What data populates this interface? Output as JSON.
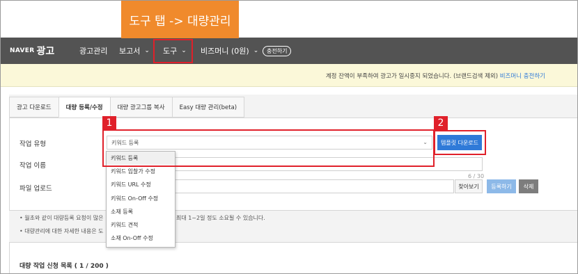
{
  "caption": "도구 탭 -> 대량관리",
  "nav": {
    "logo_naver": "NAVER",
    "logo_ad": "광고",
    "items": [
      {
        "label": "광고관리",
        "chevron": false
      },
      {
        "label": "보고서",
        "chevron": true
      },
      {
        "label": "도구",
        "chevron": true
      },
      {
        "label": "비즈머니 (0원)",
        "chevron": true
      }
    ],
    "charge_button": "충전하기",
    "chevron_icon": "chevron-down-icon"
  },
  "notice": {
    "text": "계정 잔액이 부족하여 광고가 일시중지 되었습니다. (브랜드검색 제외)",
    "link": "비즈머니 충전하기"
  },
  "tabs": [
    {
      "label": "광고 다운로드",
      "active": false
    },
    {
      "label": "대량 등록/수정",
      "active": true
    },
    {
      "label": "대량 광고그룹 복사",
      "active": false
    },
    {
      "label": "Easy 대량 관리(beta)",
      "active": false
    }
  ],
  "form": {
    "job_type_label": "작업 유형",
    "job_name_label": "작업 이름",
    "file_upload_label": "파일 업로드",
    "job_type_value": "키워드 등록",
    "counter": "6 / 30",
    "find_button": "찾아보기",
    "register_button": "등록하기",
    "delete_button": "삭제",
    "template_button": "템플릿 다운로드"
  },
  "dropdown": {
    "options": [
      "키워드 등록",
      "키워드 입찰가 수정",
      "키워드 URL 수정",
      "키워드 On-Off 수정",
      "소재 등록",
      "키워드 견적",
      "소재 On-Off 수정"
    ],
    "selected_index": 0
  },
  "notes": {
    "note1_head": "• 월초와 같이 대량등록 요청이 많은",
    "note1_tail": "최대 1~2일 정도 소요될 수 있습니다.",
    "note2": "• 대량관리에 대한 자세한 내용은 도"
  },
  "list": {
    "title": "대량 작업 신청 목록 ( 1 / 200 )"
  },
  "annotations": {
    "tag1": "1",
    "tag2": "2",
    "color": "#e0202a"
  },
  "colors": {
    "nav_bg": "#535353",
    "caption_bg": "#f08a2c",
    "primary": "#2f7ad8",
    "notice_bg": "#fbf8d9"
  }
}
